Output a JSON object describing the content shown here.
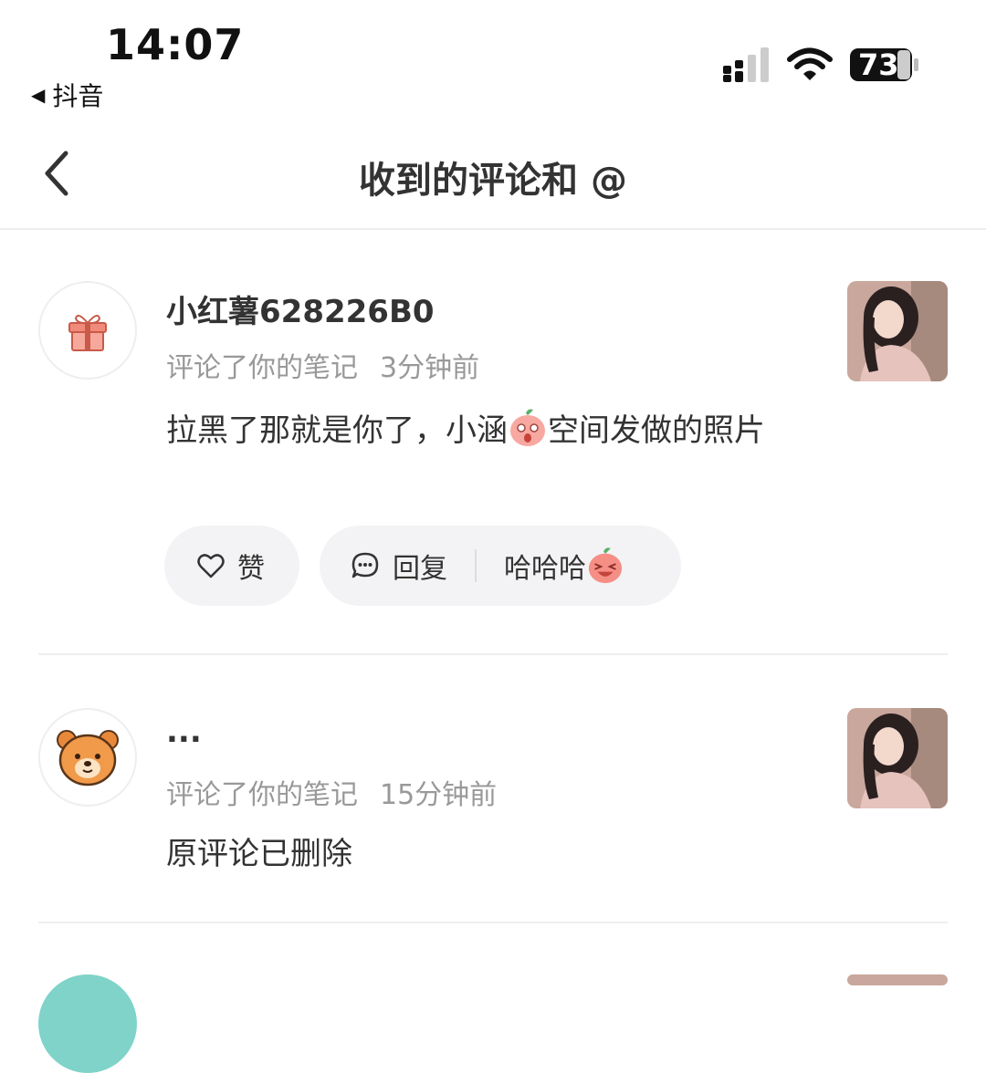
{
  "status_bar": {
    "time": "14:07",
    "back_app": "抖音",
    "battery": "73"
  },
  "nav": {
    "title": "收到的评论和 @"
  },
  "notifications": [
    {
      "username": "小红薯628226B0",
      "action": "评论了你的笔记",
      "time": "3分钟前",
      "comment_part1": "拉黑了那就是你了，小涵",
      "comment_part2": "空间发做的照片",
      "like_label": "赞",
      "reply_label": "回复",
      "quick_reply": "哈哈哈"
    },
    {
      "username": "...",
      "action": "评论了你的笔记",
      "time": "15分钟前",
      "comment": "原评论已删除"
    }
  ],
  "icons": {
    "avatar1": "gift-icon",
    "avatar2": "bear-icon",
    "like": "heart-icon",
    "reply": "speech-bubble-icon",
    "emoji": "peach-emoji-icon"
  },
  "colors": {
    "muted_text": "#999999",
    "pill_bg": "#f3f3f5",
    "divider": "#eeeeee"
  }
}
